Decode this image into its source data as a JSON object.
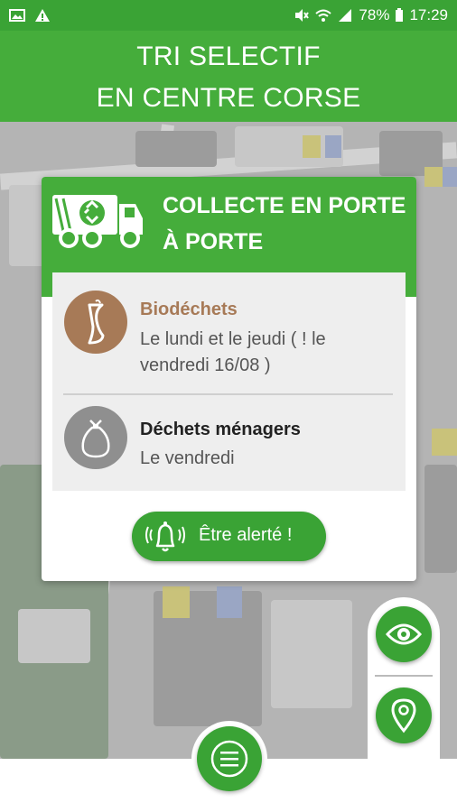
{
  "status_bar": {
    "battery": "78%",
    "time": "17:29",
    "left_icons": [
      "image-icon",
      "warning-icon"
    ],
    "right_icons": [
      "mute-icon",
      "wifi-icon",
      "signal-icon",
      "battery-icon"
    ]
  },
  "header": {
    "line1": "TRI SELECTIF",
    "line2": "EN CENTRE CORSE"
  },
  "card": {
    "title_line1": "COLLECTE EN PORTE",
    "title_line2": "À PORTE",
    "items": [
      {
        "title": "Biodéchets",
        "description": "Le lundi et le jeudi ( ! le vendredi 16/08 )",
        "icon": "apple-core-icon",
        "color": "#a77a57"
      },
      {
        "title": "Déchets ménagers",
        "description": "Le vendredi",
        "icon": "trash-bag-icon",
        "color": "#8f8f8f"
      }
    ],
    "alert_button": "Être alerté !"
  },
  "colors": {
    "primary": "#45ad3b",
    "primary_dark": "#3aa335",
    "biodechets": "#a77a57",
    "menagers": "#8f8f8f"
  }
}
